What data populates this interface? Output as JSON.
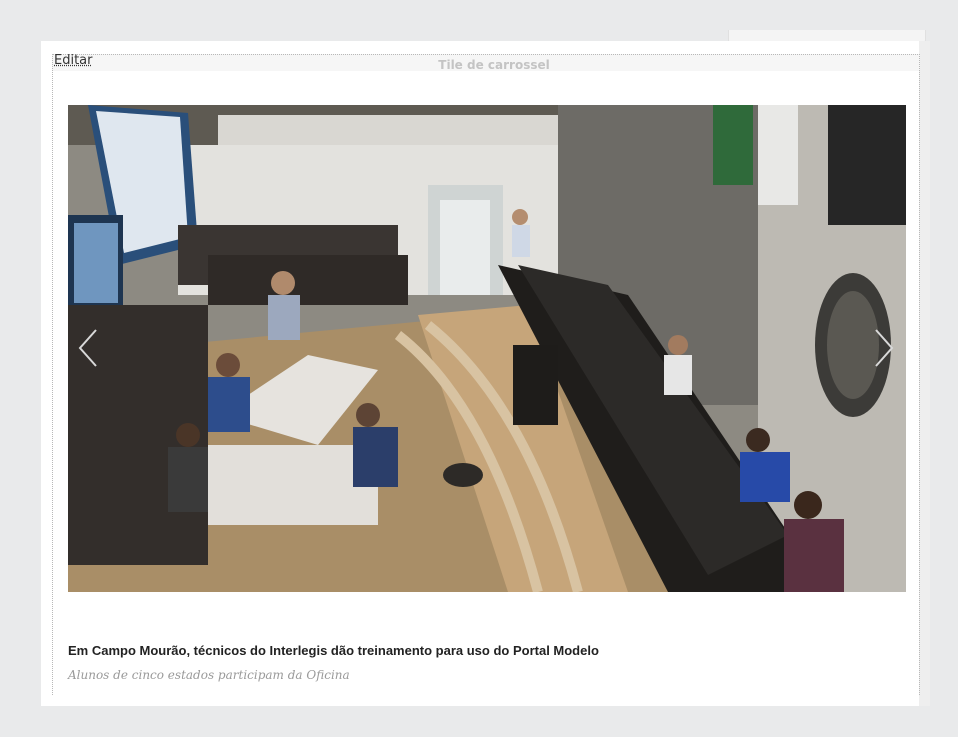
{
  "tile": {
    "edit_label": "Editar",
    "type_label": "Tile de carrossel"
  },
  "carousel": {
    "slide": {
      "image_alt": "Em Campo Mourão, técnicos do Interlegis dão treinamento para uso do Portal Modelo",
      "title": "Em Campo Mourão, técnicos do Interlegis dão treinamento para uso do Portal Modelo",
      "description": "Alunos de cinco estados participam da Oficina"
    },
    "prev_icon": "chevron-left-icon",
    "next_icon": "chevron-right-icon"
  },
  "colors": {
    "page_background": "#e9eaeb",
    "panel_background": "#ffffff",
    "caption_title": "#222222",
    "caption_description": "#9a9a9a",
    "tile_type_label": "#c4c4c4"
  }
}
